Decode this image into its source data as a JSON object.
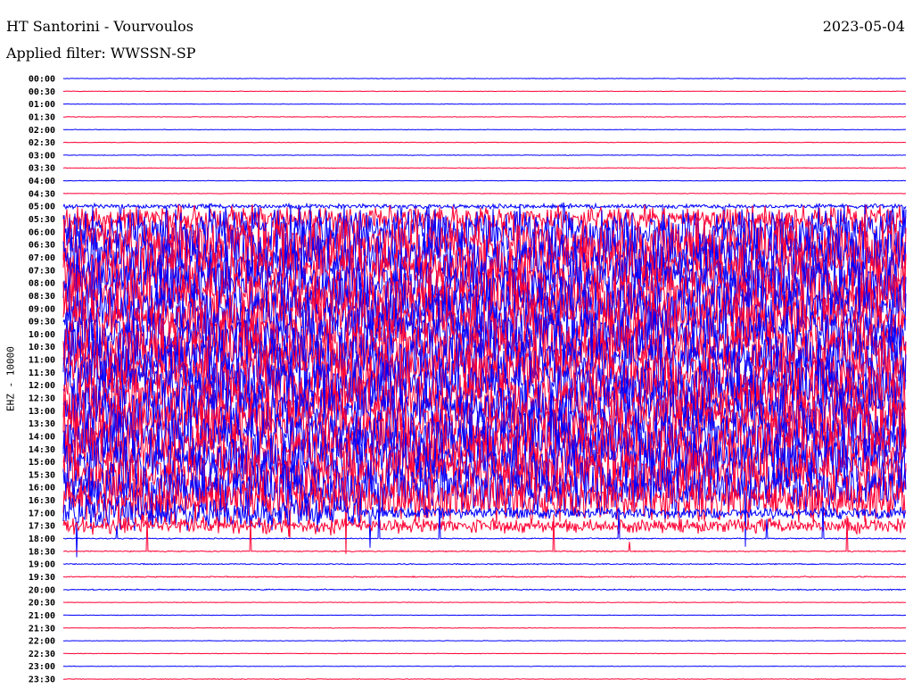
{
  "header": {
    "title": "HT Santorini - Vourvoulos",
    "date": "2023-05-04",
    "filter": "Applied filter: WWSSN-SP"
  },
  "chart_data": {
    "type": "line",
    "title": "HT Santorini - Vourvoulos",
    "subtitle": "Applied filter: WWSSN-SP",
    "ylabel": "EHZ - 10000",
    "date": "2023-05-04",
    "row_labels": [
      "00:00",
      "00:30",
      "01:00",
      "01:30",
      "02:00",
      "02:30",
      "03:00",
      "03:30",
      "04:00",
      "04:30",
      "05:00",
      "05:30",
      "06:00",
      "06:30",
      "07:00",
      "07:30",
      "08:00",
      "08:30",
      "09:00",
      "09:30",
      "10:00",
      "10:30",
      "11:00",
      "11:30",
      "12:00",
      "12:30",
      "13:00",
      "13:30",
      "14:00",
      "14:30",
      "15:00",
      "15:30",
      "16:00",
      "16:30",
      "17:00",
      "17:30",
      "18:00",
      "18:30",
      "19:00",
      "19:30",
      "20:00",
      "20:30",
      "21:00",
      "21:30",
      "22:00",
      "22:30",
      "23:00",
      "23:30"
    ],
    "trace_colors": [
      "#0000ff",
      "#ff0033"
    ],
    "relative_activity": [
      0.01,
      0.01,
      0.01,
      0.01,
      0.01,
      0.01,
      0.01,
      0.01,
      0.01,
      0.01,
      0.08,
      0.45,
      0.9,
      1,
      1,
      1,
      1,
      1,
      1,
      1,
      1,
      1,
      1,
      1,
      1,
      1,
      1,
      1,
      1,
      1,
      1,
      0.95,
      0.9,
      0.8,
      0.6,
      0.25,
      0.02,
      0.02,
      0.02,
      0.02,
      0.02,
      0.01,
      0.01,
      0.01,
      0.01,
      0.01,
      0.01,
      0.01
    ],
    "grid": false
  }
}
